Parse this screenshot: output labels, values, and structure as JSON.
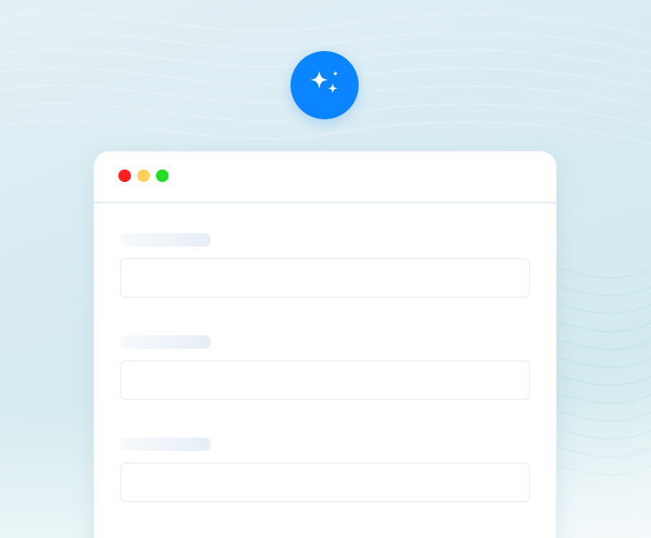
{
  "app": {
    "accent_color": "#0a84ff",
    "badge_icon": "sparkles-icon"
  },
  "window": {
    "controls": [
      {
        "name": "close",
        "color": "#ff1f1f"
      },
      {
        "name": "minimize",
        "color": "#ffd15a"
      },
      {
        "name": "maximize",
        "color": "#22dd22"
      }
    ]
  },
  "form": {
    "fields": [
      {
        "label": "",
        "value": "",
        "placeholder": ""
      },
      {
        "label": "",
        "value": "",
        "placeholder": ""
      },
      {
        "label": "",
        "value": "",
        "placeholder": ""
      }
    ]
  }
}
